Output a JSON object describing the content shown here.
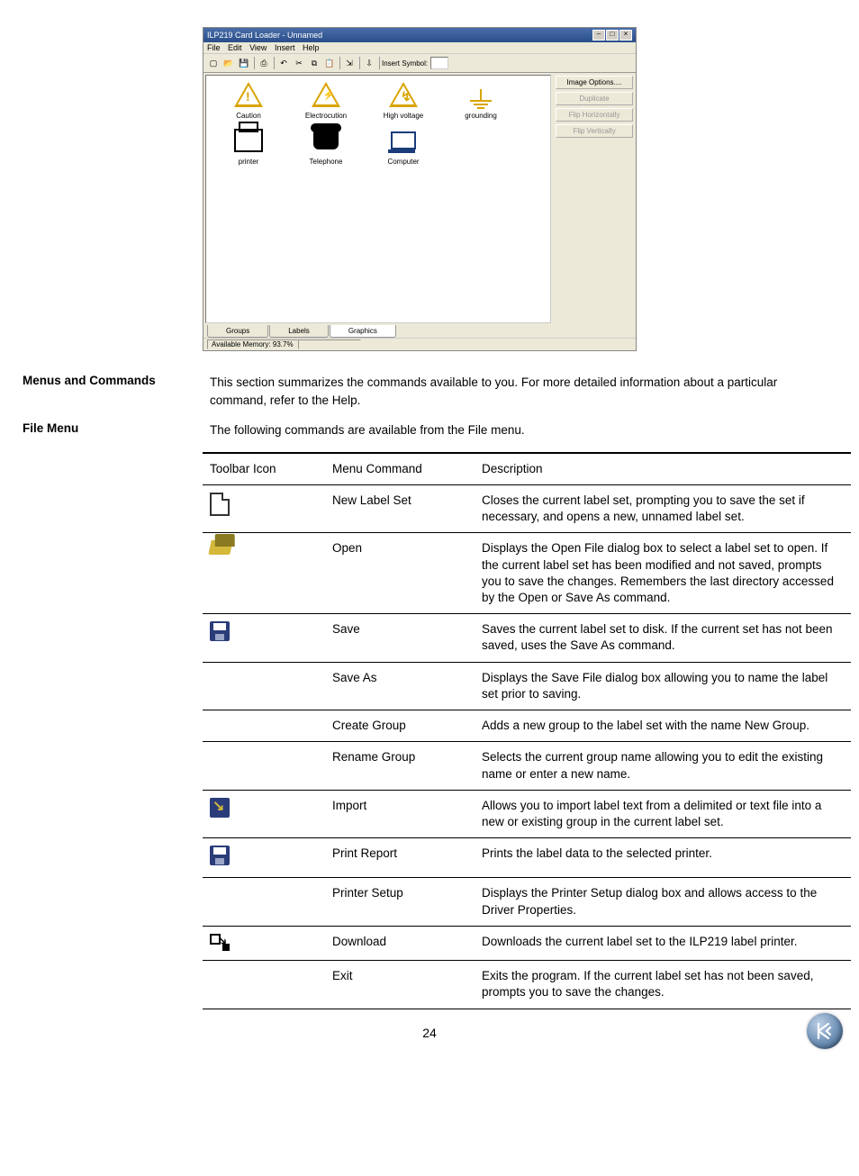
{
  "screenshot": {
    "title": "ILP219 Card Loader - Unnamed",
    "menus": [
      "File",
      "Edit",
      "View",
      "Insert",
      "Help"
    ],
    "toolbar_label": "Insert Symbol:",
    "graphics": [
      {
        "label": "Caution"
      },
      {
        "label": "Electrocution"
      },
      {
        "label": "High voltage"
      },
      {
        "label": "grounding"
      },
      {
        "label": "printer"
      },
      {
        "label": "Telephone"
      },
      {
        "label": "Computer"
      }
    ],
    "side_buttons": [
      {
        "label": "Image Options....",
        "enabled": true
      },
      {
        "label": "Duplicate",
        "enabled": false
      },
      {
        "label": "Flip Horizontally",
        "enabled": false
      },
      {
        "label": "Flip Vertically",
        "enabled": false
      }
    ],
    "tabs": [
      "Groups",
      "Labels",
      "Graphics"
    ],
    "status": "Available Memory: 93.7%"
  },
  "sections": {
    "menus_heading": "Menus and Commands",
    "menus_body": "This section summarizes the commands available to you. For more detailed information about a particular command, refer to the Help.",
    "file_heading": "File Menu",
    "file_body": "The following commands are available from the File menu."
  },
  "table": {
    "headers": [
      "Toolbar Icon",
      "Menu Command",
      "Description"
    ],
    "rows": [
      {
        "icon": "new",
        "command": "New Label Set",
        "description": "Closes the current label set, prompting you to save the set if necessary, and opens a new, unnamed label set."
      },
      {
        "icon": "open",
        "command": "Open",
        "description": "Displays the Open File dialog box to select a label set to open. If the current label set has been modified and not saved, prompts you to save the changes. Remembers the last directory accessed by the Open or Save As command."
      },
      {
        "icon": "save",
        "command": "Save",
        "description": "Saves the current label set to disk. If the current set has not been saved, uses the Save As command."
      },
      {
        "icon": "",
        "command": "Save As",
        "description": "Displays the Save File dialog box allowing you to name the label set prior to saving."
      },
      {
        "icon": "",
        "command": "Create Group",
        "description": "Adds a new group to the label set with the name New Group."
      },
      {
        "icon": "",
        "command": "Rename Group",
        "description": "Selects the current group name allowing you to edit the existing name or enter a new name."
      },
      {
        "icon": "import",
        "command": "Import",
        "description": "Allows you to import label text from a delimited or text file into a new or existing group in the current label set."
      },
      {
        "icon": "save",
        "command": "Print Report",
        "description": "Prints the label data to the selected printer."
      },
      {
        "icon": "",
        "command": "Printer Setup",
        "description": "Displays the Printer Setup dialog box and allows access to the Driver Properties."
      },
      {
        "icon": "download",
        "command": "Download",
        "description": "Downloads the current label set to the ILP219 label printer."
      },
      {
        "icon": "",
        "command": "Exit",
        "description": "Exits the program. If the current label set has not been saved, prompts you to save the changes."
      }
    ]
  },
  "page_number": "24"
}
